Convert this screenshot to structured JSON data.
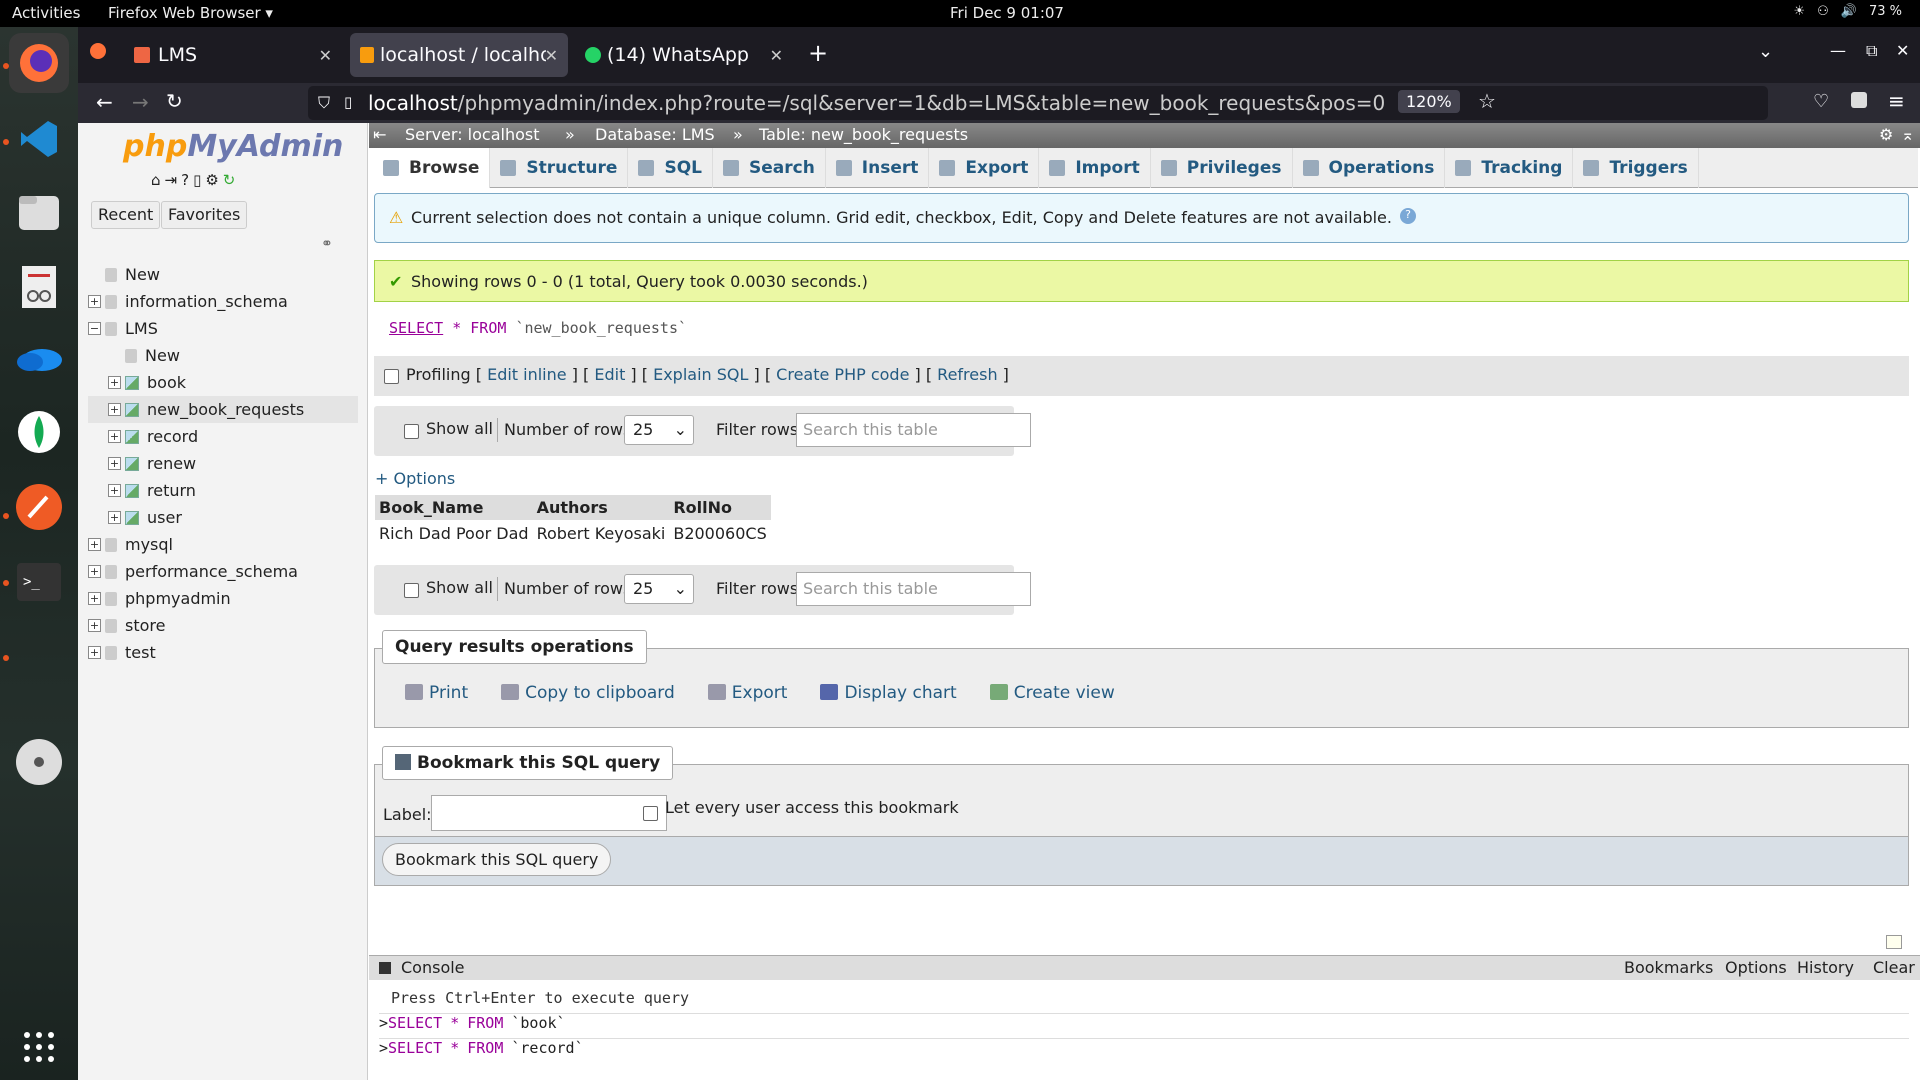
{
  "os": {
    "activities": "Activities",
    "app_menu": "Firefox Web Browser ▾",
    "clock": "Fri Dec 9  01:07",
    "battery": "73 %"
  },
  "browser": {
    "tabs": [
      {
        "label": "LMS"
      },
      {
        "label": "localhost / localho"
      },
      {
        "label": "(14) WhatsApp"
      }
    ],
    "url_host": "localhost",
    "url_path": "/phpmyadmin/index.php?route=/sql&server=1&db=LMS&table=new_book_requests&pos=0",
    "zoom": "120%"
  },
  "sidebar": {
    "logo_a": "php",
    "logo_b": "MyAdmin",
    "recent": "Recent",
    "favorites": "Favorites",
    "tree": [
      {
        "label": "New",
        "level": 0,
        "kind": "new"
      },
      {
        "label": "information_schema",
        "level": 0,
        "kind": "db"
      },
      {
        "label": "LMS",
        "level": 0,
        "kind": "db-open"
      },
      {
        "label": "New",
        "level": 1,
        "kind": "new"
      },
      {
        "label": "book",
        "level": 1,
        "kind": "table"
      },
      {
        "label": "new_book_requests",
        "level": 1,
        "kind": "table",
        "selected": true
      },
      {
        "label": "record",
        "level": 1,
        "kind": "table"
      },
      {
        "label": "renew",
        "level": 1,
        "kind": "table"
      },
      {
        "label": "return",
        "level": 1,
        "kind": "table"
      },
      {
        "label": "user",
        "level": 1,
        "kind": "table"
      },
      {
        "label": "mysql",
        "level": 0,
        "kind": "db"
      },
      {
        "label": "performance_schema",
        "level": 0,
        "kind": "db"
      },
      {
        "label": "phpmyadmin",
        "level": 0,
        "kind": "db"
      },
      {
        "label": "store",
        "level": 0,
        "kind": "db"
      },
      {
        "label": "test",
        "level": 0,
        "kind": "db"
      }
    ]
  },
  "breadcrumb": {
    "server": "Server: localhost",
    "database": "Database: LMS",
    "table": "Table: new_book_requests"
  },
  "tabs": [
    "Browse",
    "Structure",
    "SQL",
    "Search",
    "Insert",
    "Export",
    "Import",
    "Privileges",
    "Operations",
    "Tracking",
    "Triggers"
  ],
  "notice": "Current selection does not contain a unique column. Grid edit, checkbox, Edit, Copy and Delete features are not available.",
  "success": "Showing rows 0 - 0 (1 total, Query took 0.0030 seconds.)",
  "sql": {
    "kw1": "SELECT",
    "star": "*",
    "kw2": "FROM",
    "table": "`new_book_requests`"
  },
  "profiling": {
    "label": "Profiling",
    "edit_inline": "Edit inline",
    "edit": "Edit",
    "explain": "Explain SQL",
    "php": "Create PHP code",
    "refresh": "Refresh"
  },
  "nav": {
    "show_all": "Show all",
    "num_rows_label": "Number of rows:",
    "num_rows": "25",
    "filter_label": "Filter rows:",
    "filter_placeholder": "Search this table"
  },
  "options_link": "+ Options",
  "results": {
    "columns": [
      "Book_Name",
      "Authors",
      "RollNo"
    ],
    "rows": [
      [
        "Rich Dad Poor Dad",
        "Robert Keyosaki",
        "B200060CS"
      ]
    ]
  },
  "qro": {
    "legend": "Query results operations",
    "print": "Print",
    "copy": "Copy to clipboard",
    "export": "Export",
    "chart": "Display chart",
    "view": "Create view"
  },
  "bookmark": {
    "legend": "Bookmark this SQL query",
    "label": "Label:",
    "share": "Let every user access this bookmark",
    "button": "Bookmark this SQL query"
  },
  "console": {
    "title": "Console",
    "bookmarks": "Bookmarks",
    "options": "Options",
    "history": "History",
    "clear": "Clear",
    "hint": "Press Ctrl+Enter to execute query",
    "lines": [
      {
        "prompt": ">",
        "kw1": "SELECT",
        "star": "*",
        "kw2": "FROM",
        "table": "`book`"
      },
      {
        "prompt": ">",
        "kw1": "SELECT",
        "star": "*",
        "kw2": "FROM",
        "table": "`record`"
      }
    ]
  }
}
